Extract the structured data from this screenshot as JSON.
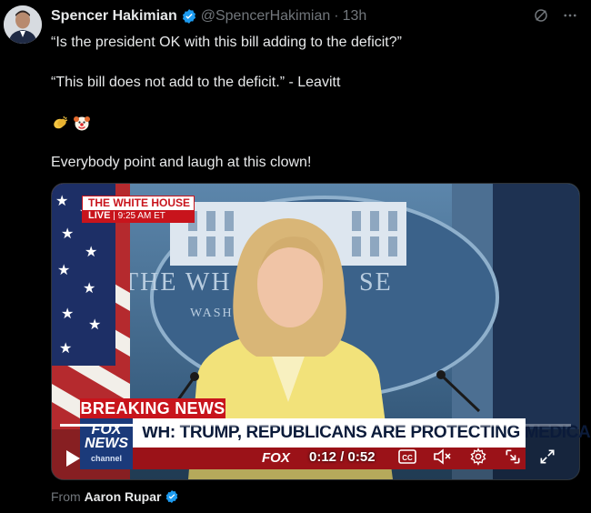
{
  "tweet": {
    "author_name": "Spencer Hakimian",
    "author_handle": "@SpencerHakimian",
    "separator": "·",
    "time": "13h",
    "lines": [
      "“Is the president OK with this bill adding to the deficit?”",
      "“This bill does not add to the deficit.” - Leavitt",
      "Everybody point and laugh at this clown!"
    ],
    "emojis": [
      "clapping-hands",
      "clown-face"
    ]
  },
  "video": {
    "bug_title": "THE WHITE HOUSE",
    "bug_live": "LIVE",
    "bug_time": "9:25 AM ET",
    "backdrop_text_left": "THE WH",
    "backdrop_text_right": "SE",
    "backdrop_text_small": "WASH",
    "breaking": "BREAKING NEWS",
    "headline": "WH: TRUMP, REPUBLICANS ARE PROTECTING MEDICAID",
    "network_top": "FOX",
    "network_mid": "NEWS",
    "network_sub": "channel",
    "strip_text": "FOX",
    "elapsed": "0:12",
    "duration": "0:52",
    "timecode": "0:12 / 0:52",
    "progress": 0.23,
    "cc_label": "CC"
  },
  "attribution": {
    "prefix": "From",
    "source": "Aaron Rupar"
  },
  "colors": {
    "background": "#000000",
    "text": "#e7e9ea",
    "muted": "#71767b",
    "verified": "#1d9bf0",
    "fox_red": "#c8141c",
    "fox_blue": "#1b3a7a"
  }
}
